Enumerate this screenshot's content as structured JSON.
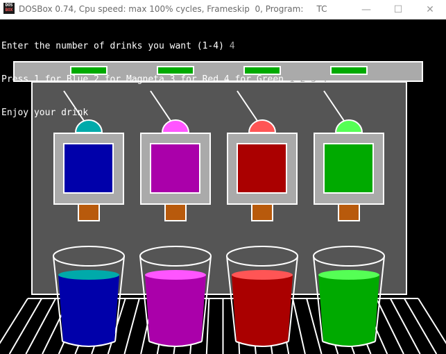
{
  "window": {
    "icon_label_top": "DOS",
    "icon_label_bottom": "BOX",
    "title": "DOSBox 0.74, Cpu speed: max 100% cycles, Frameskip  0, Program:     TC",
    "minimize_symbol": "—",
    "maximize_symbol": "☐",
    "close_symbol": "✕"
  },
  "console": {
    "line1_prompt": "Enter the number of drinks you want (1-4) ",
    "line1_input": "4",
    "line2_prompt": "Press 1 for Blue 2 for Magneta 3 for Red 4 for Green ",
    "line2_input": "1 2 3 4",
    "line3": "Enjoy your drink"
  },
  "colors": {
    "screen_bg": "#000000",
    "machine_frame": "#aaaaaa",
    "machine_panel": "#555555",
    "indicator": "#00aa00",
    "nozzle": "#b85a0c",
    "outline": "#ffffff"
  },
  "dispensers": [
    {
      "name": "Blue",
      "fill": "#0000aa",
      "bulb": "#00aaaa"
    },
    {
      "name": "Magneta",
      "fill": "#aa00aa",
      "bulb": "#ff55ff"
    },
    {
      "name": "Red",
      "fill": "#aa0000",
      "bulb": "#ff5555"
    },
    {
      "name": "Green",
      "fill": "#00aa00",
      "bulb": "#55ff55"
    }
  ],
  "cups": [
    {
      "drink": "Blue",
      "liquid": "#0000aa",
      "surface": "#00aaaa"
    },
    {
      "drink": "Magneta",
      "liquid": "#aa00aa",
      "surface": "#ff55ff"
    },
    {
      "drink": "Red",
      "liquid": "#aa0000",
      "surface": "#ff5555"
    },
    {
      "drink": "Green",
      "liquid": "#00aa00",
      "surface": "#55ff55"
    }
  ]
}
